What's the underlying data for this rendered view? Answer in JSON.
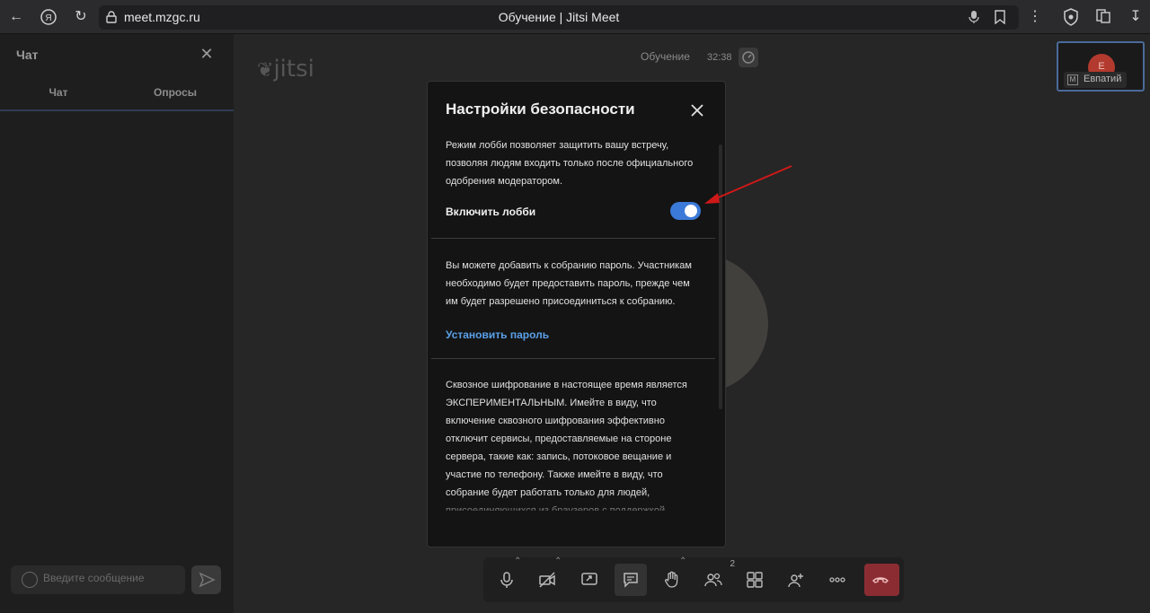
{
  "browser": {
    "url": "meet.mzgc.ru",
    "tab_title": "Обучение | Jitsi Meet"
  },
  "chat": {
    "title": "Чат",
    "tabs": [
      "Чат",
      "Опросы"
    ],
    "input_placeholder": "Введите сообщение"
  },
  "conference": {
    "logo": "jitsi",
    "meeting_name": "Обучение",
    "timer": "32:38",
    "participant_initial": "Е",
    "participant_name": "Евпатий",
    "moderator_mark": "M",
    "participants_count": "2"
  },
  "modal": {
    "title": "Настройки безопасности",
    "lobby_desc": "Режим лобби позволяет защитить вашу встречу, позволяя людям входить только после официального одобрения модератором.",
    "lobby_toggle_label": "Включить лобби",
    "lobby_enabled": true,
    "password_desc": "Вы можете добавить к собранию пароль. Участникам необходимо будет предоставить пароль, прежде чем им будет разрешено присоединиться к собранию.",
    "set_password_label": "Установить пароль",
    "e2ee_desc": "Сквозное шифрование в настоящее время является ЭКСПЕРИМЕНТАЛЬНЫМ. Имейте в виду, что включение сквозного шифрования эффективно отключит сервисы, предоставляемые на стороне сервера, такие как: запись, потоковое вещание и участие по телефону. Также имейте в виду, что собрание будет работать только для людей, присоединяющихся из браузеров с поддержкой"
  },
  "colors": {
    "accent": "#3b7ad8",
    "link": "#5aa0e8",
    "hangup": "#8b2c33",
    "annotation_arrow": "#d01818"
  }
}
